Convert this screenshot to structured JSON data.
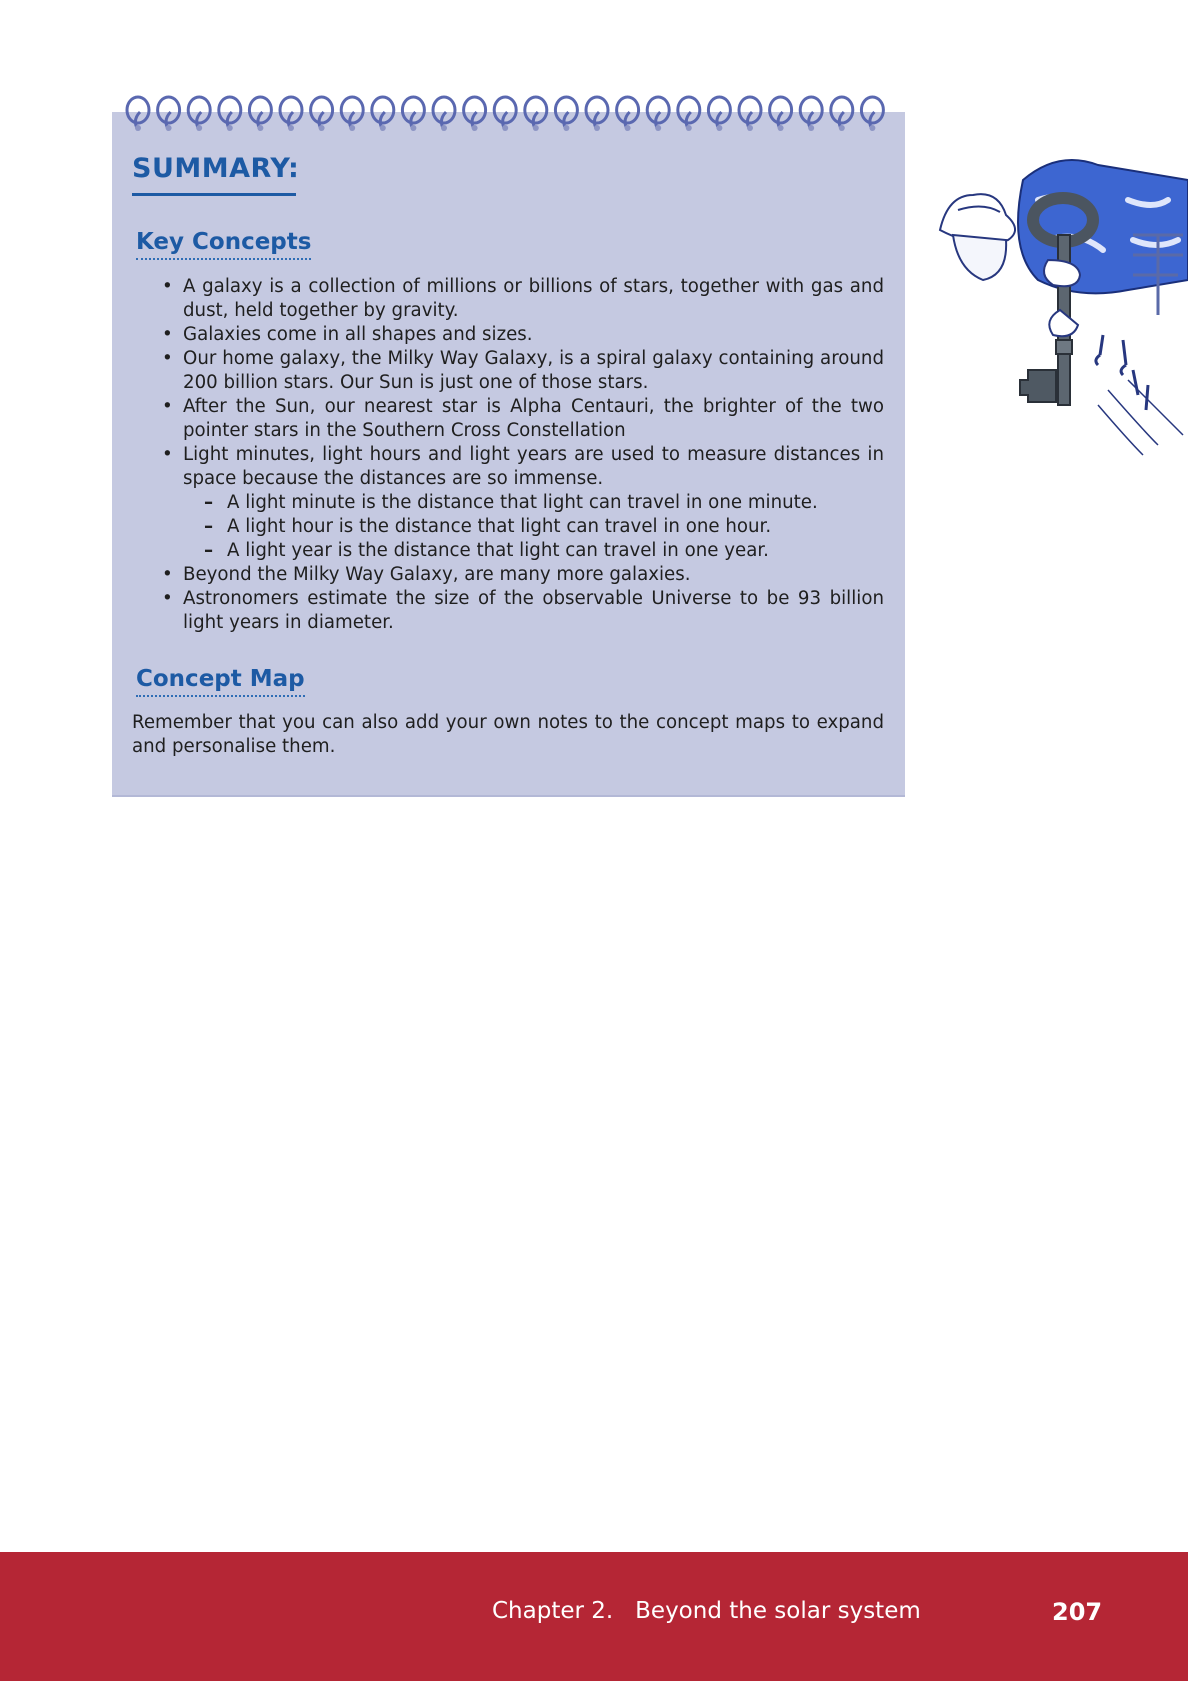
{
  "summary_title": "SUMMARY:",
  "key_concepts": {
    "heading": "Key Concepts",
    "items": [
      "A galaxy is a collection of millions or billions of stars, together with gas and dust, held together by gravity.",
      "Galaxies come in all shapes and sizes.",
      "Our home galaxy, the Milky Way Galaxy, is a spiral galaxy containing around 200 billion stars. Our Sun is just one of those stars.",
      "After the Sun, our nearest star is Alpha Centauri, the brighter of the two pointer stars in the Southern Cross Constellation",
      "Light minutes, light hours and light years are used to measure distances in space because the distances are so immense.",
      "Beyond the Milky Way Galaxy, are many more galaxies.",
      "Astronomers estimate the size of the observable Universe to be 93 billion light years in diameter."
    ],
    "sub_items": [
      "A light minute is the distance that light can travel in one minute.",
      "A light hour is the distance that light can travel in one hour.",
      "A light year is the distance that light can travel in one year."
    ]
  },
  "concept_map": {
    "heading": "Concept Map",
    "text": "Remember that you can also add your own notes to the concept maps to expand and personalise them."
  },
  "illustration": {
    "name": "person-holding-key-illustration"
  },
  "footer": {
    "chapter": "Chapter 2.   Beyond the solar system",
    "page_number": "207",
    "color": "#b52635"
  },
  "colors": {
    "panel": "#c5c9e1",
    "heading": "#1d5aa4"
  }
}
